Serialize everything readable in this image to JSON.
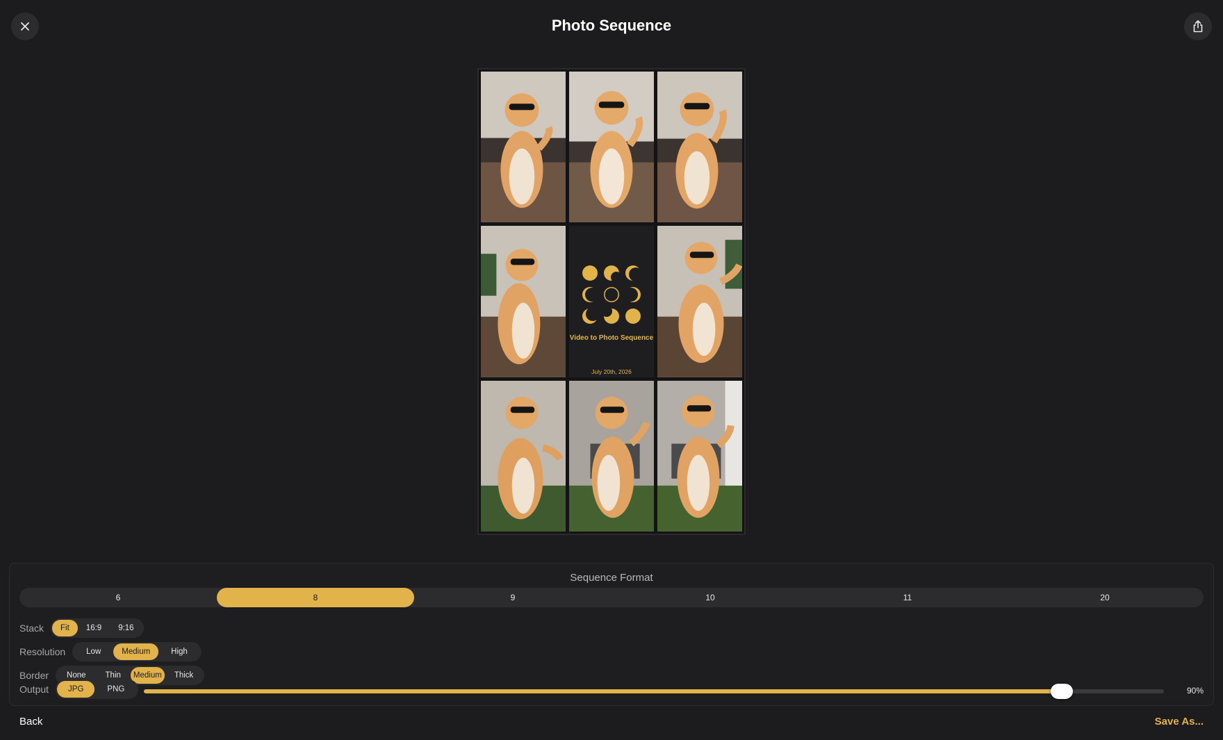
{
  "window": {
    "title": "Photo Sequence"
  },
  "toolbar": {
    "close_icon": "close-icon",
    "share_icon": "share-icon"
  },
  "preview": {
    "center_title": "Video to Photo Sequence",
    "center_date": "July 20th, 2026",
    "accent_color": "#e2b34a"
  },
  "panel": {
    "title": "Sequence Format",
    "formats": [
      "6",
      "8",
      "9",
      "10",
      "11",
      "20"
    ],
    "format_selected": "8",
    "stack": {
      "label": "Stack",
      "options": [
        "Fit",
        "16:9",
        "9:16"
      ],
      "selected": "Fit"
    },
    "resolution": {
      "label": "Resolution",
      "options": [
        "Low",
        "Medium",
        "High"
      ],
      "selected": "Medium"
    },
    "border": {
      "label": "Border",
      "options": [
        "None",
        "Thin",
        "Medium",
        "Thick"
      ],
      "selected": "Medium"
    },
    "output": {
      "label": "Output",
      "options": [
        "JPG",
        "PNG"
      ],
      "selected": "JPG"
    },
    "quality": {
      "value": 90,
      "label": "90%"
    }
  },
  "footer": {
    "back_label": "Back",
    "save_label": "Save As..."
  }
}
